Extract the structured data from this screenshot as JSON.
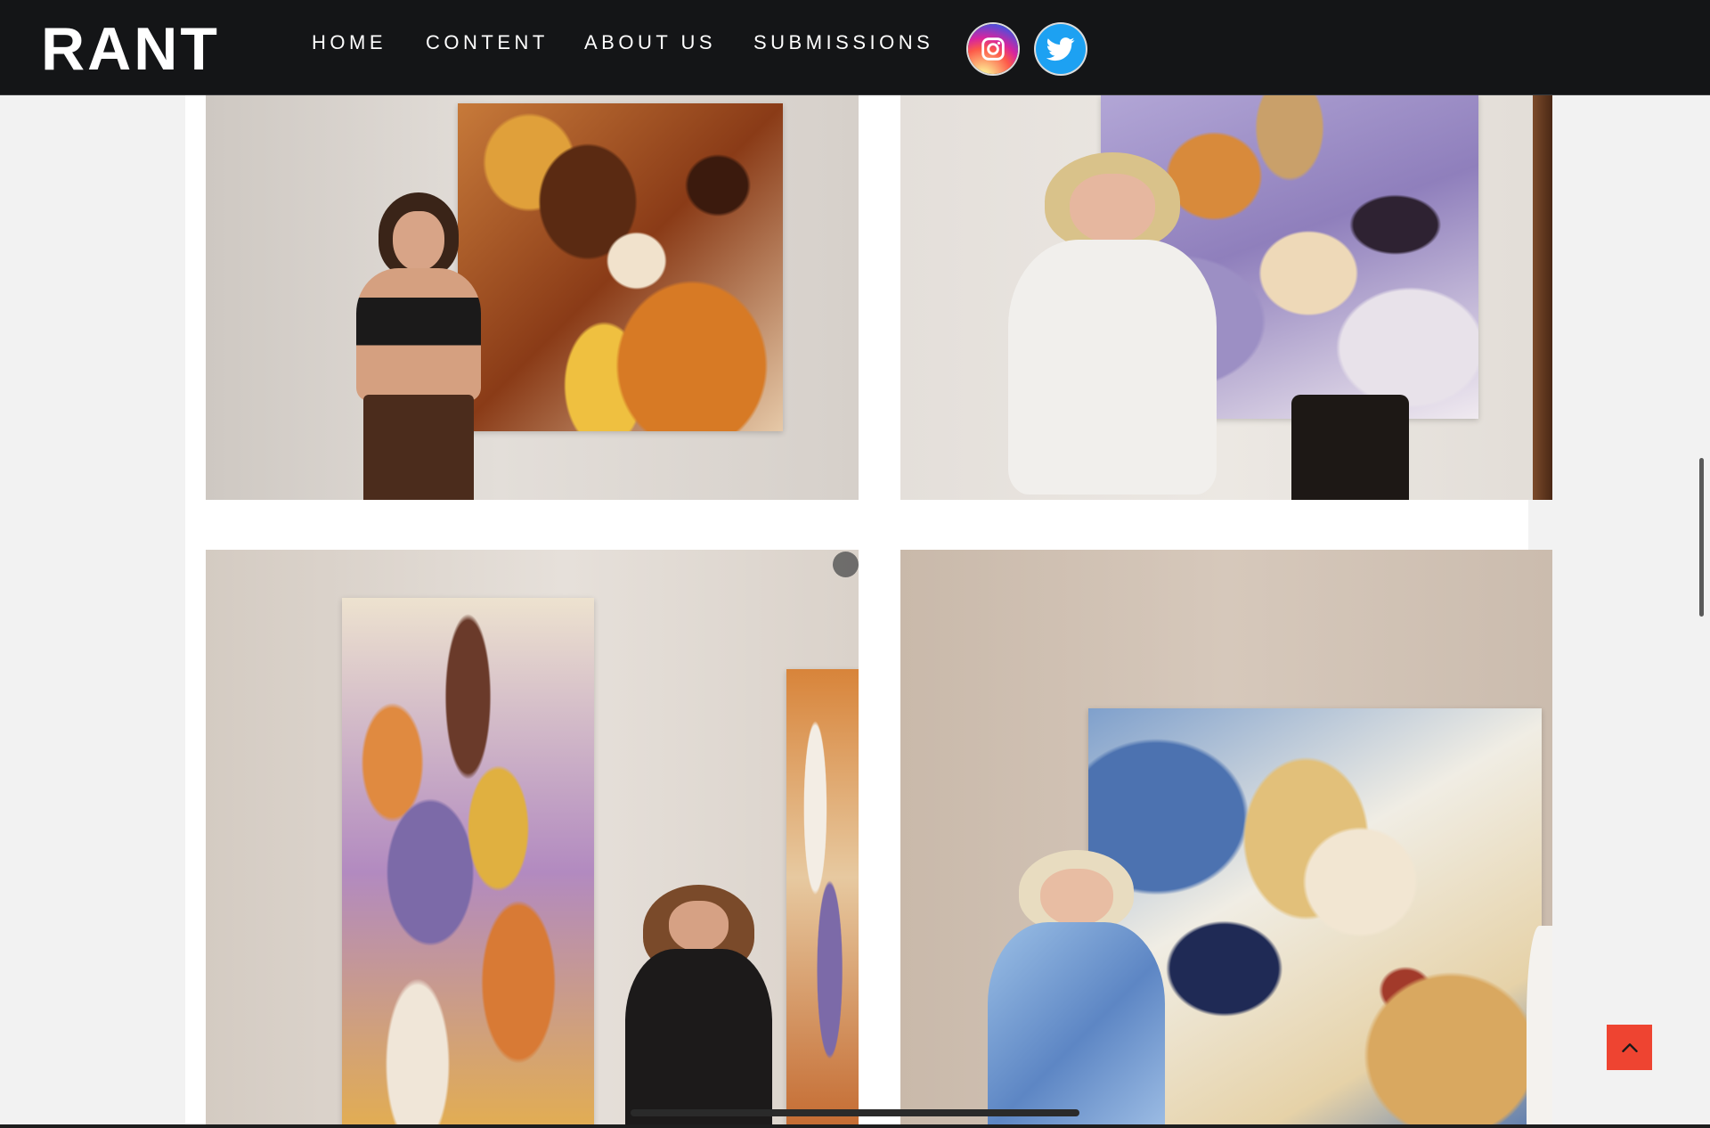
{
  "brand": {
    "logo_text": "RANT"
  },
  "nav": {
    "items": [
      {
        "label": "HOME"
      },
      {
        "label": "CONTENT"
      },
      {
        "label": "ABOUT US"
      },
      {
        "label": "SUBMISSIONS"
      }
    ]
  },
  "social": [
    {
      "icon": "instagram-icon"
    },
    {
      "icon": "twitter-icon"
    }
  ],
  "scroll_to_top": {
    "icon": "chevron-up-icon"
  },
  "colors": {
    "header_background": "#141517",
    "page_background": "#f2f2f2",
    "content_background": "#ffffff",
    "accent": "#ee4431",
    "twitter_blue": "#1da1f2"
  }
}
